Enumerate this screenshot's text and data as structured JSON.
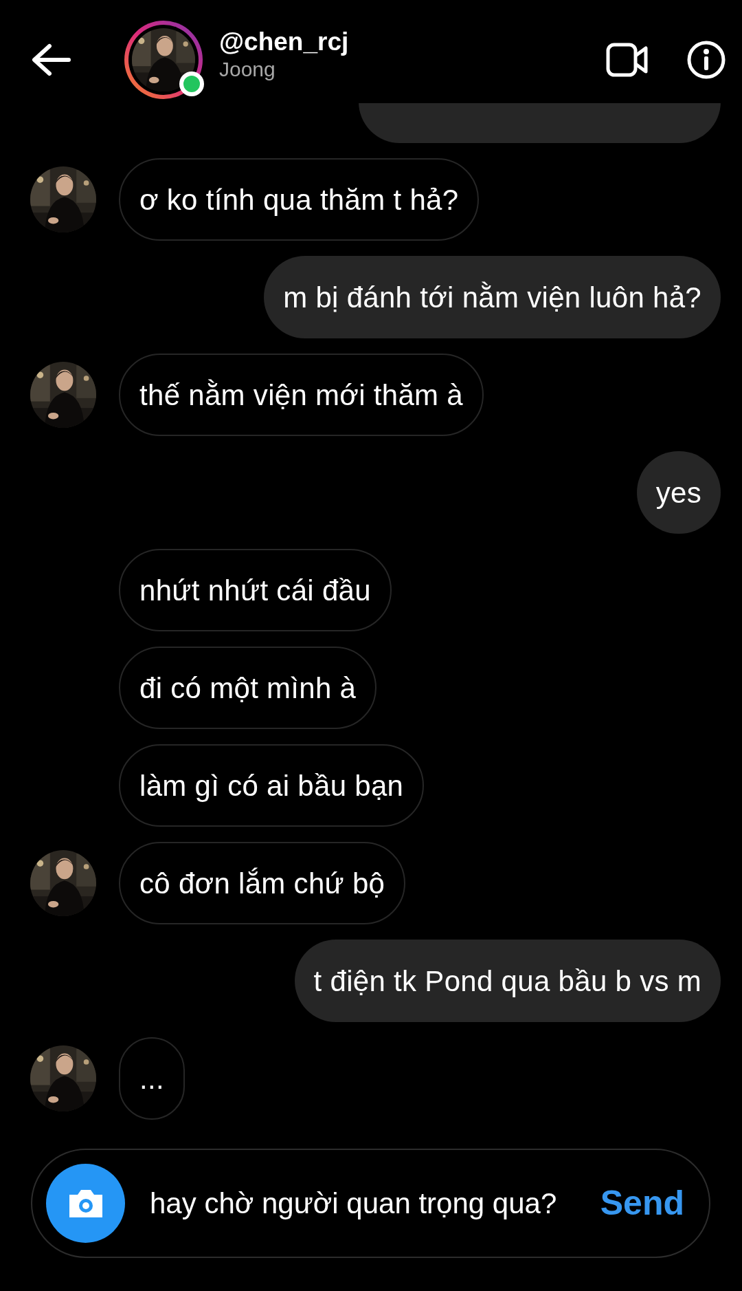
{
  "header": {
    "username": "@chen_rcj",
    "display_name": "Joong",
    "online": true
  },
  "messages": [
    {
      "kind": "cut_off"
    },
    {
      "kind": "incoming",
      "text": "ơ ko tính qua thăm t hả?",
      "show_avatar": true
    },
    {
      "kind": "outgoing",
      "text": "m bị đánh tới nằm viện luôn hả?",
      "show_avatar": false
    },
    {
      "kind": "incoming",
      "text": "thế nằm viện mới thăm à",
      "show_avatar": true
    },
    {
      "kind": "outgoing",
      "text": "yes",
      "show_avatar": false
    },
    {
      "kind": "incoming",
      "text": "nhứt nhứt cái đầu",
      "show_avatar": false
    },
    {
      "kind": "incoming",
      "text": "đi có một mình à",
      "show_avatar": false
    },
    {
      "kind": "incoming",
      "text": "làm gì có ai bầu bạn",
      "show_avatar": false
    },
    {
      "kind": "incoming",
      "text": "cô đơn lắm chứ bộ",
      "show_avatar": true
    },
    {
      "kind": "outgoing",
      "text": "t điện tk Pond qua bầu b vs m",
      "show_avatar": false
    },
    {
      "kind": "incoming",
      "text": "...",
      "show_avatar": true
    }
  ],
  "composer": {
    "value": "hay chờ người quan trọng qua?",
    "send_label": "Send"
  }
}
